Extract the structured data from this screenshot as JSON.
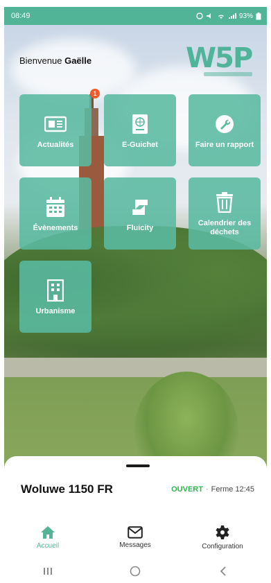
{
  "status_bar": {
    "time": "08:49",
    "battery": "93%"
  },
  "header": {
    "greeting": "Bienvenue",
    "user_name": "Gaëlle",
    "logo_text": "W5P"
  },
  "tiles": [
    {
      "label": "Actualités",
      "icon": "newspaper-icon",
      "badge": "1"
    },
    {
      "label": "E-Guichet",
      "icon": "passport-icon"
    },
    {
      "label": "Faire un rapport",
      "icon": "wrench-icon"
    },
    {
      "label": "Évènements",
      "icon": "calendar-icon"
    },
    {
      "label": "Fluicity",
      "icon": "fluicity-icon"
    },
    {
      "label": "Calendrier des déchets",
      "icon": "trash-icon"
    },
    {
      "label": "Urbanisme",
      "icon": "building-icon"
    }
  ],
  "location": {
    "name": "Woluwe 1150 FR",
    "status": "OUVERT",
    "separator": "·",
    "closing": "Ferme 12:45"
  },
  "tabbar": [
    {
      "label": "Accueil",
      "icon": "home-icon",
      "active": true
    },
    {
      "label": "Messages",
      "icon": "envelope-icon",
      "active": false
    },
    {
      "label": "Configuration",
      "icon": "gear-icon",
      "active": false
    }
  ],
  "colors": {
    "accent": "#55b497",
    "open": "#2fb34e",
    "badge": "#f15a2a"
  }
}
